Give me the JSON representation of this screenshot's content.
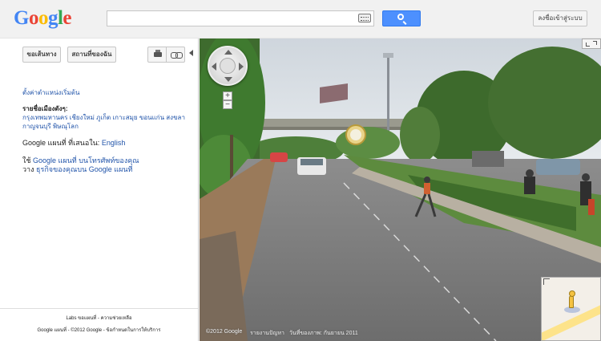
{
  "header": {
    "logo_text": "Google",
    "logo_colors": [
      "#4285f4",
      "#ea4335",
      "#fbbc05",
      "#4285f4",
      "#34a853",
      "#ea4335"
    ],
    "search_value": "",
    "signin_label": "ลงชื่อเข้าสู่ระบบ",
    "accent": "#4d90fe"
  },
  "sidebar": {
    "directions_label": "ขอเส้นทาง",
    "my_places_label": "สถานที่ของฉัน",
    "set_default_location": "ตั้งค่าตำแหน่งเริ่มต้น",
    "cities_heading": "รายชื่อเมืองดังๆ:",
    "cities_line1": "กรุงเทพมหานคร  เชียงใหม่  ภูเก็ต  เกาะสมุย  ขอนแก่น  สงขลา",
    "cities_line2": "กาญจนบุรี  พิษณุโลก",
    "offered_in_prefix": "Google แผนที่ ที่เสนอใน:",
    "offered_in_lang": "English",
    "mobile_prefix": "ใช้",
    "mobile_link": "Google แผนที่ บนโทรศัพท์ของคุณ",
    "business_prefix": "วาง",
    "business_link": "ธุรกิจของคุณบน Google แผนที่",
    "footer_line1": "Labs  ขอแผนที่ - ความช่วยเหลือ",
    "footer_line2": "Google แผนที่ - ©2012 Google - ข้อกำหนดในการให้บริการ"
  },
  "streetview": {
    "copyright": "©2012 Google",
    "terms": "รายงานปัญหา",
    "date": "วันที่ของภาพ: กันยายน 2011",
    "zoom_in": "+",
    "zoom_out": "−"
  }
}
